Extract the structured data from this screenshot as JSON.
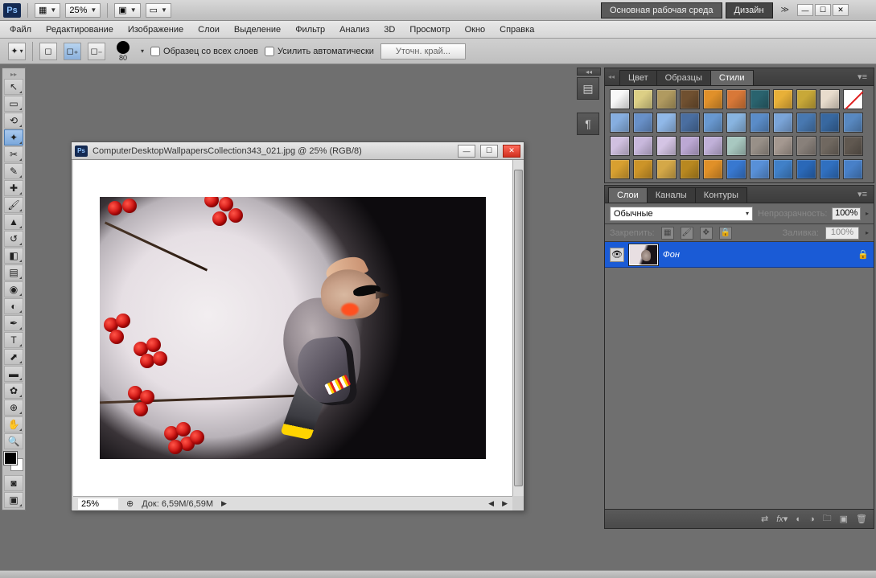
{
  "titlebar": {
    "zoom": "25%",
    "workspace_main": "Основная рабочая среда",
    "workspace_design": "Дизайн"
  },
  "menu": [
    "Файл",
    "Редактирование",
    "Изображение",
    "Слои",
    "Выделение",
    "Фильтр",
    "Анализ",
    "3D",
    "Просмотр",
    "Окно",
    "Справка"
  ],
  "options": {
    "brush_size": "80",
    "chk_all_layers": "Образец со всех слоев",
    "chk_auto_enhance": "Усилить автоматически",
    "refine_edge": "Уточн. край..."
  },
  "document": {
    "title": "ComputerDesktopWallpapersCollection343_021.jpg @ 25% (RGB/8)",
    "status_zoom": "25%",
    "status_doc": "Док: 6,59M/6,59M"
  },
  "panels": {
    "styles_tabs": [
      "Цвет",
      "Образцы",
      "Стили"
    ],
    "layers_tabs": [
      "Слои",
      "Каналы",
      "Контуры"
    ],
    "blend_mode": "Обычные",
    "opacity_label": "Непрозрачность:",
    "opacity_value": "100%",
    "lock_label": "Закрепить:",
    "fill_label": "Заливка:",
    "fill_value": "100%",
    "layer_name": "Фон"
  },
  "swatches": [
    "#f8f8f8",
    "#dccf85",
    "#b09a60",
    "#705030",
    "#e0902a",
    "#d87838",
    "#2a636e",
    "#e8b038",
    "#c8a838",
    "#e8dccc",
    "none",
    "#86aee0",
    "#6890c8",
    "#90b8e8",
    "#4a6ea0",
    "#6898d0",
    "#88b4e0",
    "#5a8cc8",
    "#7aa4d8",
    "#4878b0",
    "#3868a0",
    "#5888c0",
    "#d0c0e0",
    "#c8b8dc",
    "#d4c4e4",
    "#bca8d4",
    "#c0b0d8",
    "#a8c8c0",
    "#989088",
    "#a49890",
    "#88807a",
    "#706860",
    "#605850",
    "#d8a030",
    "#cc9428",
    "#d4a848",
    "#b88820",
    "#e09028",
    "#3878d0",
    "#5890d8",
    "#4080c8",
    "#2a68b8",
    "#3070c0",
    "#4880c8"
  ]
}
